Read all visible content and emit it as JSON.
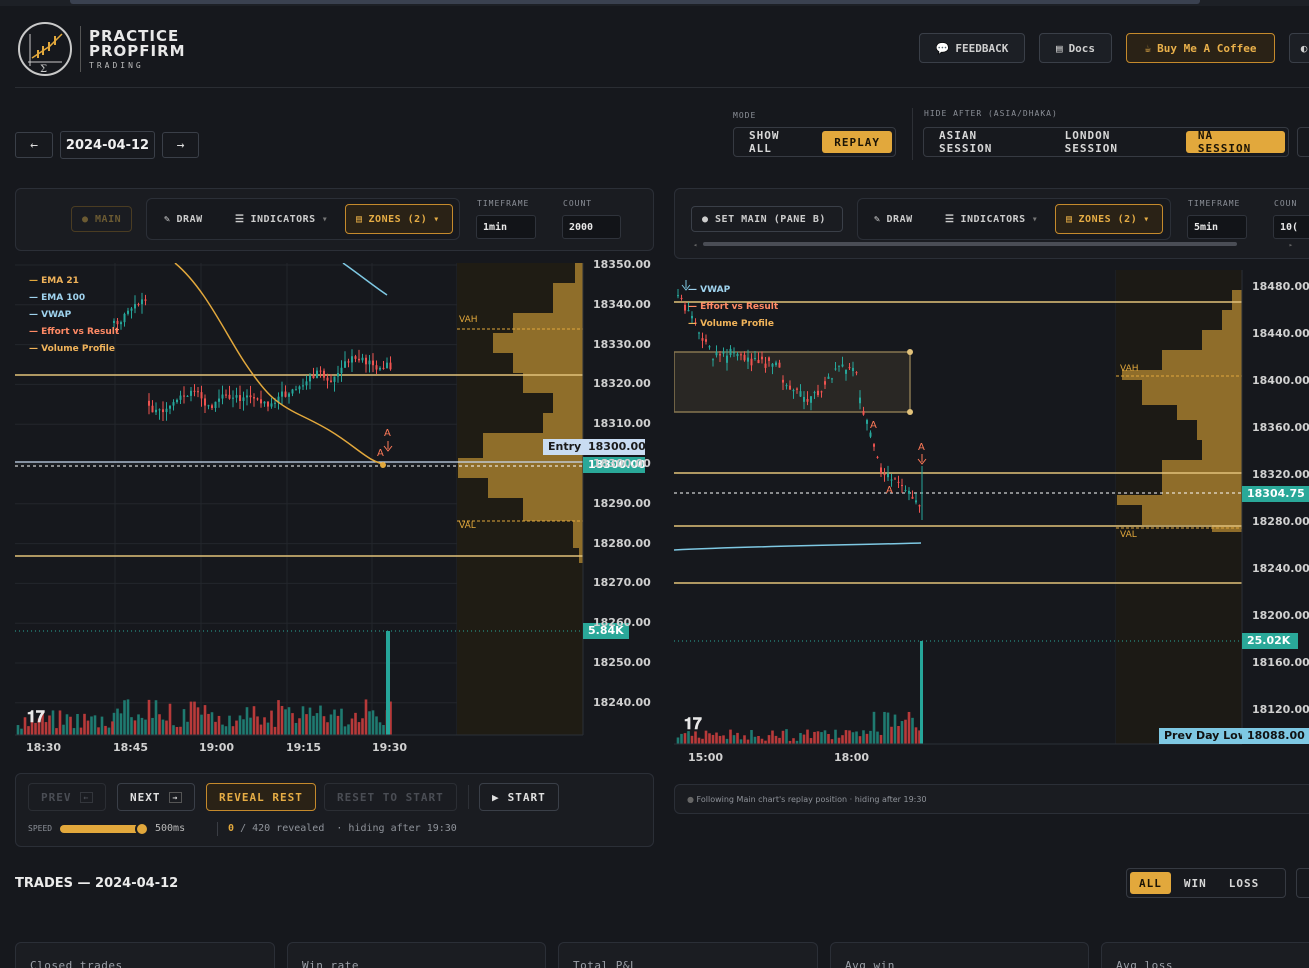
{
  "brand": {
    "line1": "PRACTICE",
    "line2": "PROPFIRM",
    "line3": "TRADING",
    "accent": "#e2a83c"
  },
  "header": {
    "feedback": "FEEDBACK",
    "docs": "Docs",
    "coffee": "Buy Me A Coffee"
  },
  "date_nav": {
    "prev": "←",
    "date": "2024-04-12",
    "next": "→"
  },
  "mode": {
    "label": "MODE",
    "options": [
      "SHOW ALL",
      "REPLAY"
    ],
    "selected": "REPLAY"
  },
  "hide_after": {
    "label": "HIDE AFTER (ASIA/DHAKA)",
    "options": [
      "ASIAN SESSION",
      "LONDON SESSION",
      "NA SESSION"
    ],
    "selected": "NA SESSION"
  },
  "left_pane": {
    "main_badge": "● MAIN",
    "draw": "DRAW",
    "indicators": "INDICATORS",
    "zones": "ZONES (2)",
    "timeframe_label": "TIMEFRAME",
    "timeframe": "1min",
    "count_label": "COUNT",
    "count": "2000",
    "legend": [
      "EMA 21",
      "EMA 100",
      "VWAP",
      "Effort vs Result",
      "Volume Profile"
    ],
    "y_ticks": [
      "18350.00",
      "18340.00",
      "18330.00",
      "18320.00",
      "18310.00",
      "18300.00",
      "18290.00",
      "18280.00",
      "18270.00",
      "18260.00",
      "18250.00",
      "18240.00"
    ],
    "x_ticks": [
      "18:30",
      "18:45",
      "19:00",
      "19:15",
      "19:30"
    ],
    "entry_label": "Entry",
    "entry_price": "18300.00",
    "last_price": "18300.00",
    "volume": "5.84K",
    "vah": "VAH",
    "val": "VAL",
    "marker": "A"
  },
  "right_pane": {
    "set_main": "● SET MAIN (PANE B)",
    "draw": "DRAW",
    "indicators": "INDICATORS",
    "zones": "ZONES (2)",
    "timeframe_label": "TIMEFRAME",
    "timeframe": "5min",
    "count_label": "COUN",
    "count": "10(",
    "legend": [
      "VWAP",
      "Effort vs Result",
      "Volume Profile"
    ],
    "y_ticks": [
      "18480.00",
      "18440.00",
      "18400.00",
      "18360.00",
      "18320.00",
      "18280.00",
      "18240.00",
      "18200.00",
      "18160.00",
      "18120.00"
    ],
    "x_ticks": [
      "15:00",
      "18:00"
    ],
    "last_price": "18304.75",
    "volume": "25.02K",
    "prev_day_low_label": "Prev Day Low",
    "prev_day_low": "18088.00",
    "vah": "VAH",
    "val": "VAL",
    "marker": "A",
    "status": "Following Main chart's replay position · hiding after 19:30"
  },
  "replay": {
    "prev": "PREV",
    "next": "NEXT",
    "reveal": "REVEAL REST",
    "reset": "RESET TO START",
    "start": "START",
    "speed_label": "SPEED",
    "speed": "500ms",
    "speed_fraction": 0.95,
    "revealed_count": "0",
    "revealed_text": "/ 420 revealed",
    "hiding": "hiding after 19:30"
  },
  "trades": {
    "title": "TRADES — 2024-04-12",
    "filters": [
      "ALL",
      "WIN",
      "LOSS"
    ],
    "selected": "ALL"
  },
  "stats": [
    "Closed trades",
    "Win rate",
    "Total P&L",
    "Avg win",
    "Avg loss"
  ],
  "colors": {
    "up": "#26a69a",
    "down": "#ef5350",
    "gold": "#e2a83c",
    "vwap": "#7ec8e3",
    "teal": "#2aa899"
  }
}
